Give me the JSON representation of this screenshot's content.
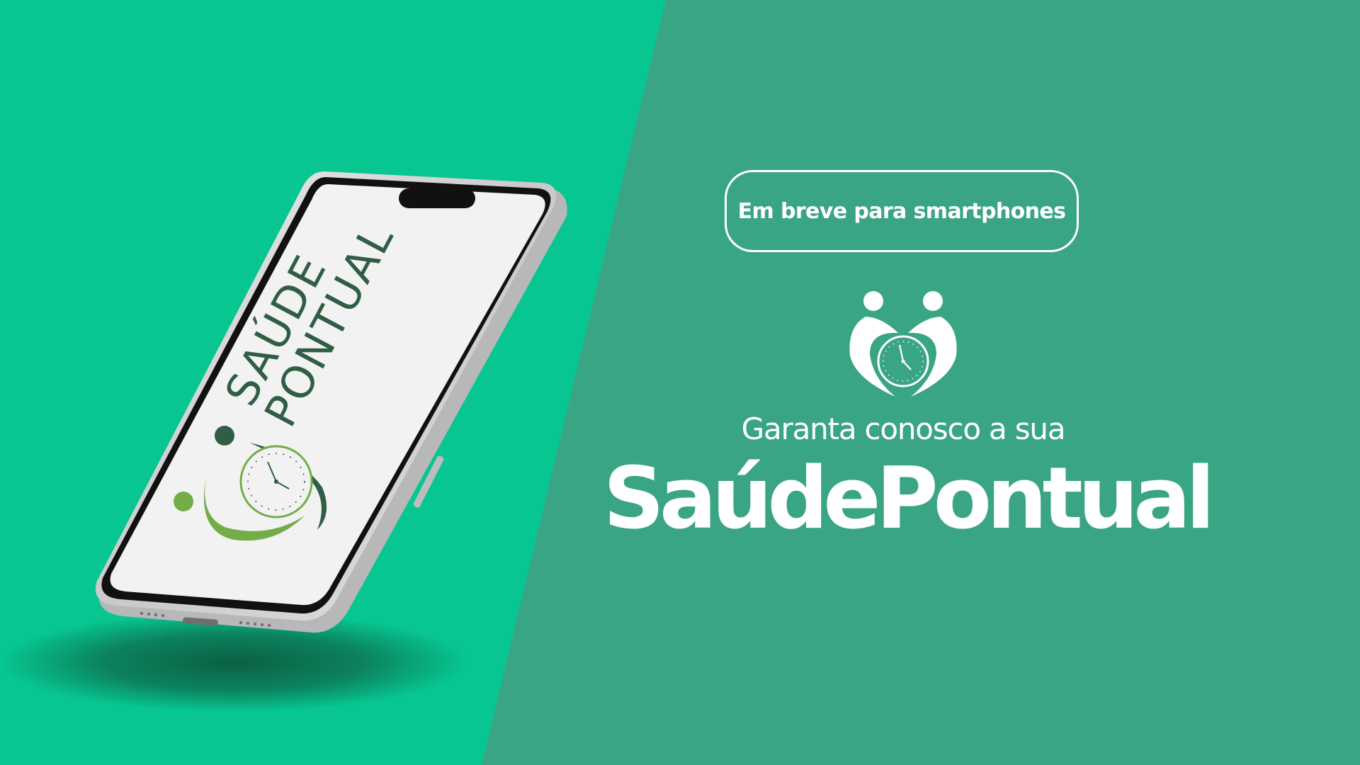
{
  "colors": {
    "bg_left": "#07c692",
    "bg_right": "#3aa584",
    "white": "#ffffff",
    "logo_dark_green": "#2f5e45",
    "logo_light_green": "#74ad48"
  },
  "badge": {
    "label": "Em breve para smartphones"
  },
  "tagline": "Garanta conosco a sua",
  "brand_name": "SaúdePontual",
  "phone": {
    "logo_text_line1": "SAÚDE",
    "logo_text_line2": "PONTUAL"
  },
  "icons": [
    "heart-people-clock-icon",
    "clock-icon",
    "phone-mockup"
  ]
}
